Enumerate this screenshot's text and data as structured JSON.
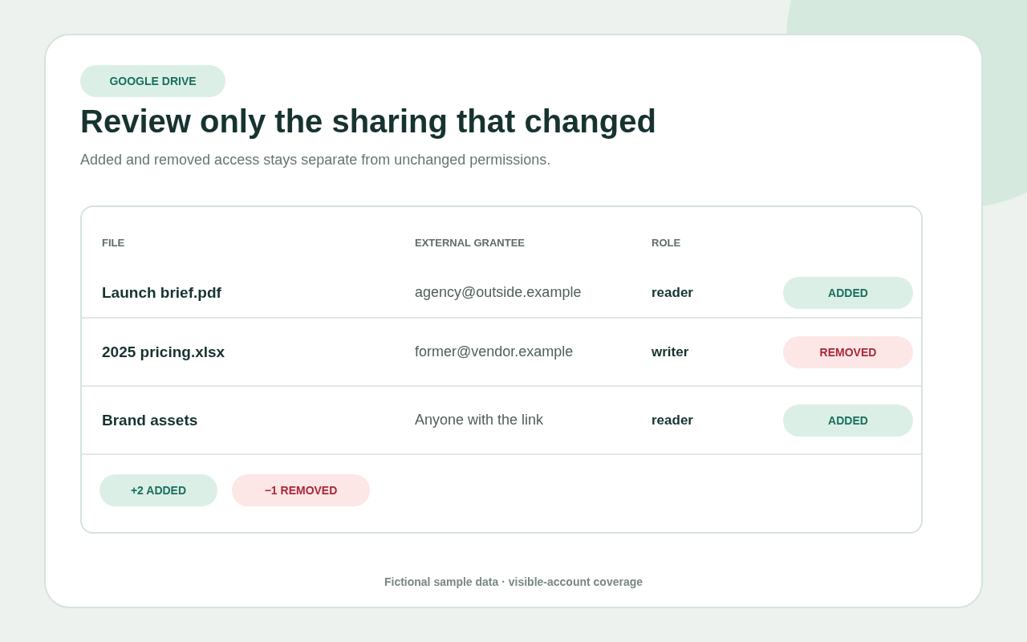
{
  "badge": "GOOGLE DRIVE",
  "title": "Review only the sharing that changed",
  "subtitle": "Added and removed access stays separate from unchanged permissions.",
  "table": {
    "columns": [
      "FILE",
      "EXTERNAL GRANTEE",
      "ROLE"
    ],
    "rows": [
      {
        "file": "Launch brief.pdf",
        "grantee": "agency@outside.example",
        "role": "reader",
        "status": {
          "label": "ADDED",
          "kind": "added"
        }
      },
      {
        "file": "2025 pricing.xlsx",
        "grantee": "former@vendor.example",
        "role": "writer",
        "status": {
          "label": "REMOVED",
          "kind": "removed"
        }
      },
      {
        "file": "Brand assets",
        "grantee": "Anyone with the link",
        "role": "reader",
        "status": {
          "label": "ADDED",
          "kind": "added"
        }
      }
    ]
  },
  "summary": [
    {
      "label": "+2 ADDED",
      "kind": "added"
    },
    {
      "label": "−1 REMOVED",
      "kind": "removed"
    }
  ],
  "footer": "Fictional sample data · visible-account coverage"
}
